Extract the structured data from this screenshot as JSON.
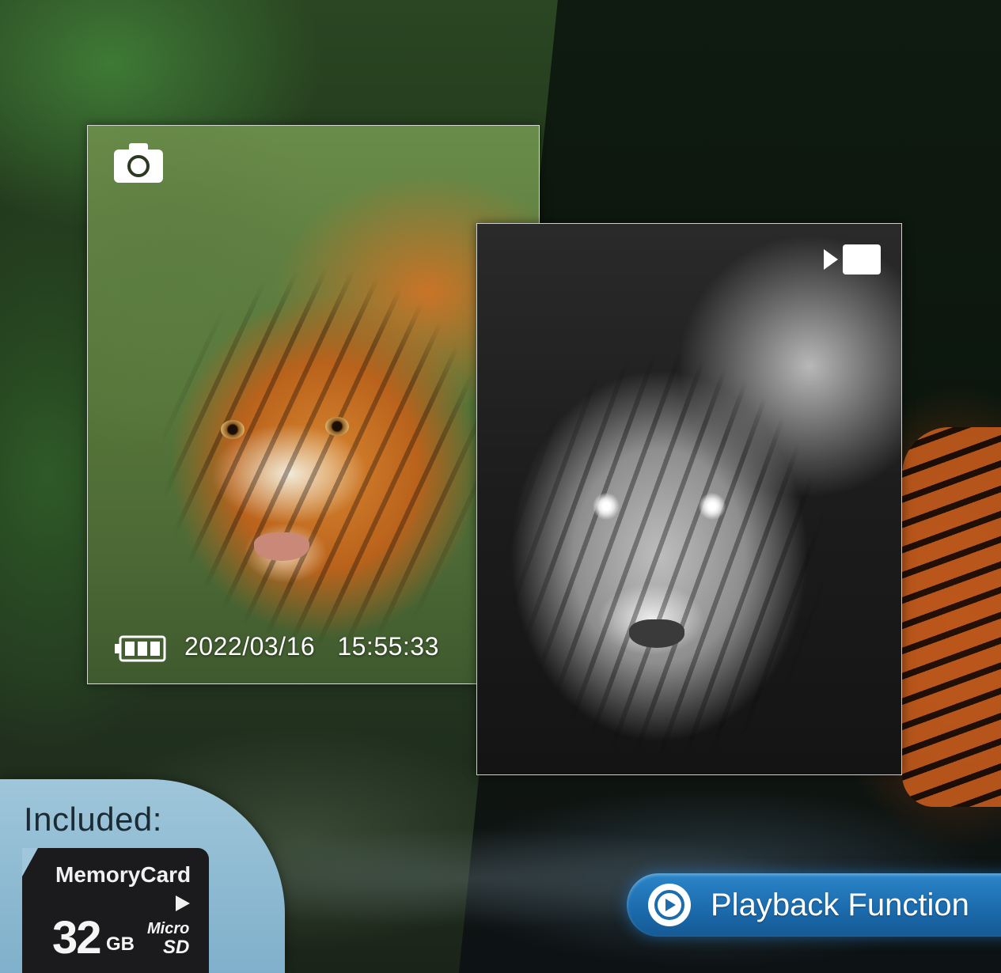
{
  "photo_overlay": {
    "date": "2022/03/16",
    "time": "15:55:33"
  },
  "icons": {
    "photo_mode": "camera-icon",
    "video_mode": "video-camera-icon",
    "battery": "battery-full-icon",
    "playback": "playback-icon"
  },
  "included": {
    "title": "Included:",
    "card_brand": "MemoryCard",
    "capacity": "32",
    "unit": "GB",
    "micro": "Micro",
    "sd": "SD"
  },
  "feature": {
    "label": "Playback Function"
  },
  "colors": {
    "accent_blue": "#1c6cae",
    "badge_blue": "#9fc6da"
  }
}
